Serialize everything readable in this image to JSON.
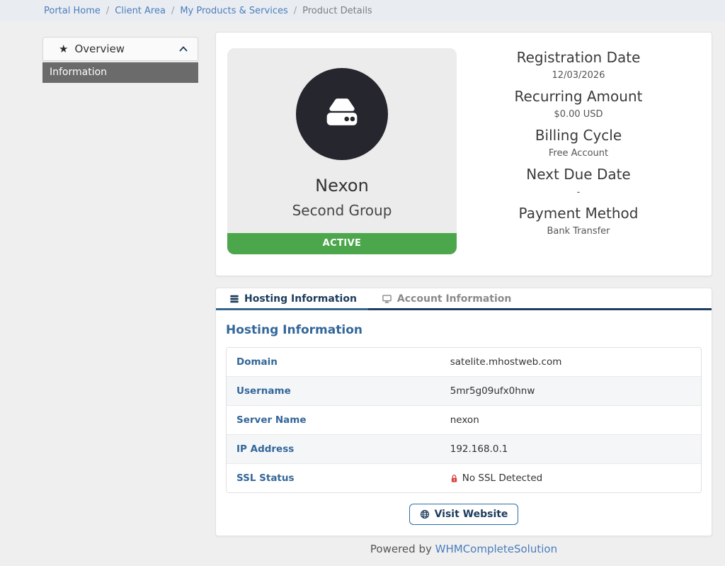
{
  "breadcrumb": {
    "separator": "/",
    "links": [
      {
        "label": "Portal Home"
      },
      {
        "label": "Client Area"
      },
      {
        "label": "My Products & Services"
      }
    ],
    "current": "Product Details"
  },
  "sidebar": {
    "header": {
      "label": "Overview",
      "icon": "star-icon",
      "collapse_icon": "chevron-up-icon"
    },
    "items": [
      {
        "label": "Information",
        "active": true
      }
    ]
  },
  "product": {
    "icon": "hard-drive-icon",
    "name": "Nexon",
    "group": "Second Group",
    "status": "ACTIVE"
  },
  "summary": {
    "pairs": [
      {
        "label": "Registration Date",
        "value": "12/03/2026"
      },
      {
        "label": "Recurring Amount",
        "value": "$0.00 USD"
      },
      {
        "label": "Billing Cycle",
        "value": "Free Account"
      },
      {
        "label": "Next Due Date",
        "value": "-"
      },
      {
        "label": "Payment Method",
        "value": "Bank Transfer"
      }
    ]
  },
  "tabs": [
    {
      "label": "Hosting Information",
      "icon": "server-icon",
      "active": true
    },
    {
      "label": "Account Information",
      "icon": "monitor-icon",
      "active": false
    }
  ],
  "hosting": {
    "title": "Hosting Information",
    "rows": [
      {
        "label": "Domain",
        "value": "satelite.mhostweb.com"
      },
      {
        "label": "Username",
        "value": "5mr5g09ufx0hnw"
      },
      {
        "label": "Server Name",
        "value": "nexon"
      },
      {
        "label": "IP Address",
        "value": "192.168.0.1"
      },
      {
        "label": "SSL Status",
        "value": "No SSL Detected",
        "icon": "lock-icon"
      }
    ]
  },
  "actions": {
    "visit_website": "Visit Website",
    "icon": "globe-icon"
  },
  "footer": {
    "prefix": "Powered by",
    "link_label": "WHMCompleteSolution"
  },
  "colors": {
    "status_active_green": "#4CA64C",
    "accent_blue": "#336699",
    "link_blue": "#4a7dbd",
    "tab_active_navy": "#1d3c5c",
    "ssl_red": "#d64541",
    "sidebar_active_bg": "#6b6b6b"
  }
}
